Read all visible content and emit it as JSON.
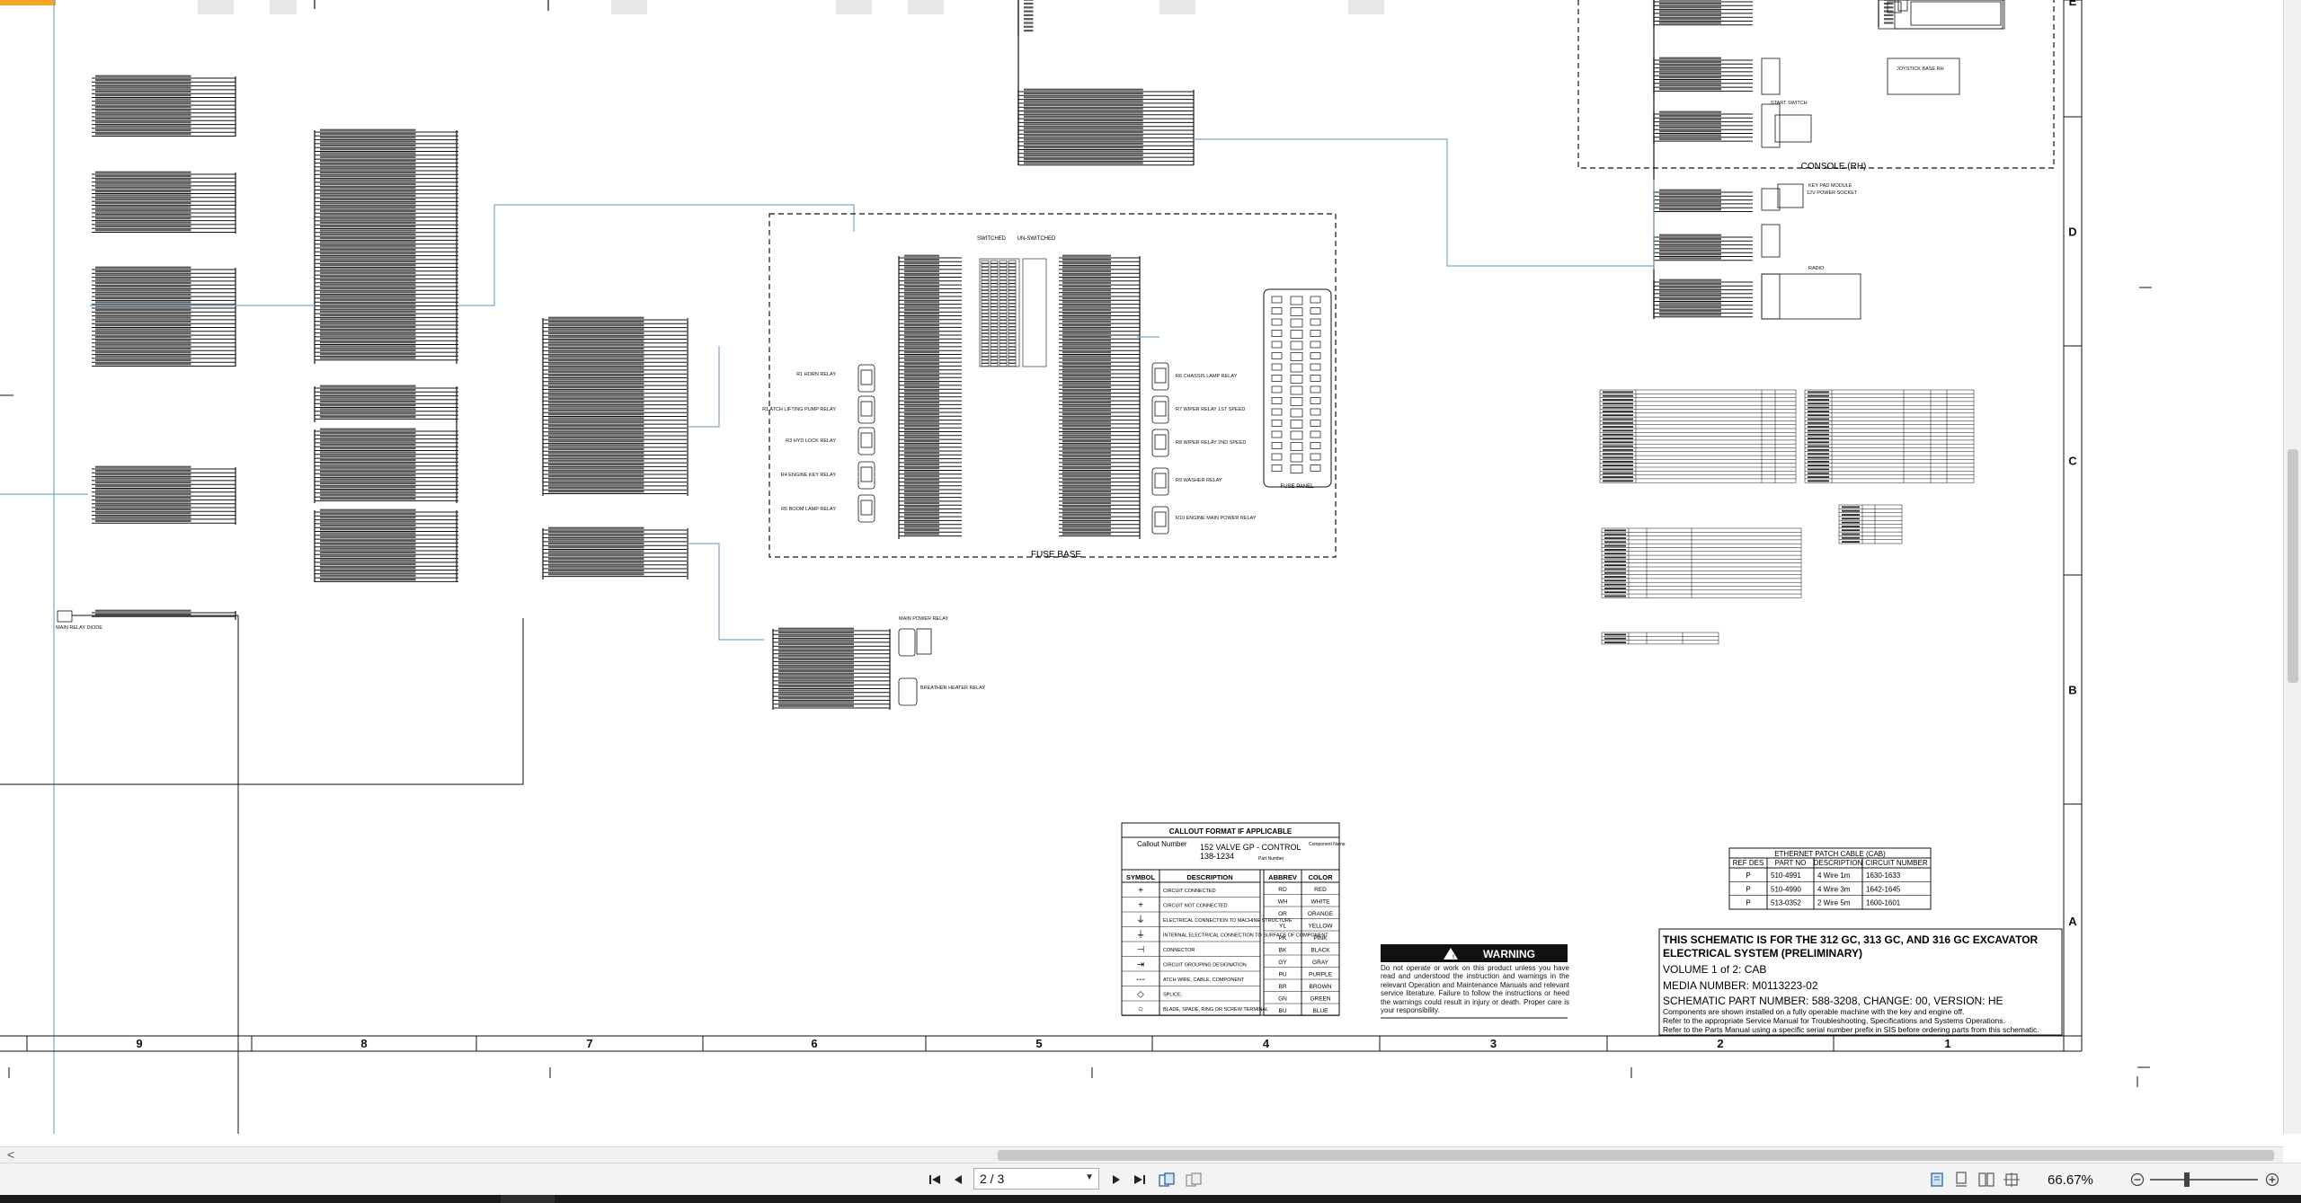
{
  "schematic": {
    "zone_columns": [
      "9",
      "8",
      "7",
      "6",
      "5",
      "4",
      "3",
      "2",
      "1"
    ],
    "zone_rows": [
      "E",
      "D",
      "C",
      "B",
      "A"
    ],
    "labels": {
      "console_rh": "CONSOLE (RH)",
      "fuse_base": "FUSE BASE",
      "fuse_panel": "FUSE PANEL",
      "switched": "SWITCHED",
      "un_switched": "UN-SWITCHED"
    },
    "callout_format": {
      "heading": "CALLOUT FORMAT IF APPLICABLE",
      "callout_number": "Callout Number",
      "example_component": "152 VALVE GP - CONTROL",
      "example_part": "138-1234",
      "part_number_label": "Part Number",
      "component_name_label": "Component Name"
    },
    "symbol_table": {
      "headers": [
        "SYMBOL",
        "DESCRIPTION"
      ],
      "rows": [
        {
          "symbol": "+",
          "description": "CIRCUIT CONNECTED"
        },
        {
          "symbol": "+",
          "description": "CIRCUIT NOT CONNECTED"
        },
        {
          "symbol": "⏚",
          "description": "ELECTRICAL CONNECTION TO MACHINE STRUCTURE"
        },
        {
          "symbol": "⏚",
          "description": "INTERNAL ELECTRICAL CONNECTION TO SURFACE OF COMPONENT"
        },
        {
          "symbol": "⊣",
          "description": "CONNECTOR"
        },
        {
          "symbol": "⇥",
          "description": "CIRCUIT GROUPING DESIGNATION"
        },
        {
          "symbol": "---",
          "description": "ATCH WIRE, CABLE, COMPONENT"
        },
        {
          "symbol": "◇",
          "description": "SPLICE"
        },
        {
          "symbol": "○",
          "description": "BLADE, SPADE, RING OR SCREW TERMINAL"
        }
      ]
    },
    "color_table": {
      "headers": [
        "ABBREV",
        "COLOR"
      ],
      "rows": [
        [
          "RD",
          "RED"
        ],
        [
          "WH",
          "WHITE"
        ],
        [
          "OR",
          "ORANGE"
        ],
        [
          "YL",
          "YELLOW"
        ],
        [
          "PK",
          "PINK"
        ],
        [
          "BK",
          "BLACK"
        ],
        [
          "GY",
          "GRAY"
        ],
        [
          "PU",
          "PURPLE"
        ],
        [
          "BR",
          "BROWN"
        ],
        [
          "GN",
          "GREEN"
        ],
        [
          "BU",
          "BLUE"
        ]
      ]
    },
    "warning": {
      "title": "WARNING",
      "body": "Do not operate or work on this product unless you have read and understood the instruction and warnings in the relevant Operation and Maintenance Manuals and relevant service literature. Failure to follow the instructions or heed the warnings could result in injury or death. Proper care is your responsibility."
    },
    "ethernet_table": {
      "title": "ETHERNET PATCH CABLE (CAB)",
      "headers": [
        "REF DES",
        "PART NO",
        "DESCRIPTION",
        "CIRCUIT NUMBER"
      ],
      "rows": [
        [
          "P",
          "510-4991",
          "4 Wire 1m",
          "1630-1633"
        ],
        [
          "P",
          "510-4990",
          "4 Wire 3m",
          "1642-1645"
        ],
        [
          "P",
          "513-0352",
          "2 Wire 5m",
          "1600-1601"
        ]
      ]
    },
    "title_block": {
      "line1": "THIS SCHEMATIC IS FOR THE 312 GC, 313 GC, AND 316 GC EXCAVATOR",
      "line2": "ELECTRICAL SYSTEM (PRELIMINARY)",
      "line3": "VOLUME 1 of 2: CAB",
      "line4": "MEDIA NUMBER: M0113223-02",
      "line5": "SCHEMATIC PART NUMBER: 588-3208, CHANGE: 00, VERSION: HE",
      "note1": "Components are shown installed on a fully operable machine with the key and engine off.",
      "note2": "Refer to the appropriate Service Manual for Troubleshooting, Specifications and Systems Operations.",
      "note3": "Refer to the Parts Manual using a specific serial number prefix in SIS before ordering parts from this schematic."
    },
    "relay_labels": [
      "R1 HORN RELAY",
      "R1 ATCH LIFTING PUMP RELAY",
      "R3 HYD LOCK RELAY",
      "R4 ENGINE KEY RELAY",
      "R5 BOOM LAMP RELAY",
      "R6 CHASSIS LAMP RELAY",
      "R7 WIPER RELAY 1ST SPEED",
      "R8 WIPER RELAY 2ND SPEED",
      "R9 WASHER RELAY",
      "R10 ENGINE MAIN POWER RELAY",
      "MAIN POWER RELAY",
      "BREATHER HEATER RELAY",
      "JOYSTICK BASE RH",
      "START SWITCH",
      "KEY PAD MODULE",
      "RADIO",
      "12V POWER SOCKET",
      "MAIN RELAY DIODE"
    ]
  },
  "toolbar": {
    "page_value": "2 / 3",
    "zoom_value": "66.67%",
    "first_page_icon": "first-page-icon",
    "prev_page_icon": "prev-page-icon",
    "next_page_icon": "next-page-icon",
    "last_page_icon": "last-page-icon"
  },
  "colors": {
    "toolbar_bg": "#f3f3f3",
    "line": "#111111",
    "wire_blue": "#7aa6c8",
    "taskbar": "#1b1b1b"
  }
}
